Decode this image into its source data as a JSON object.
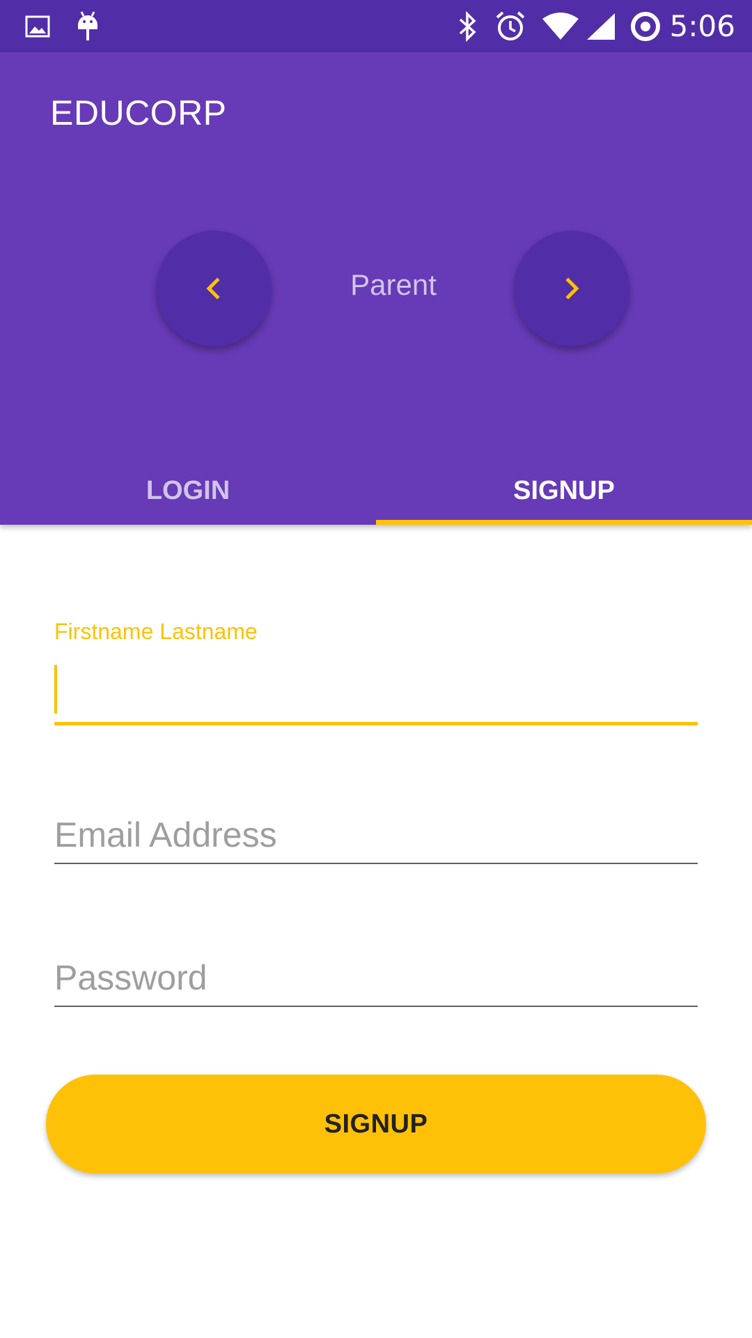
{
  "status_bar": {
    "time": "5:06",
    "icons": [
      "image-icon",
      "android-debug-icon",
      "bluetooth-icon",
      "alarm-icon",
      "wifi-icon",
      "signal-icon",
      "sync-icon"
    ]
  },
  "app_bar": {
    "title": "EDUCORP",
    "role_selector": {
      "current_role": "Parent",
      "prev_icon": "chevron-left-icon",
      "next_icon": "chevron-right-icon"
    }
  },
  "tabs": [
    {
      "label": "LOGIN",
      "active": false
    },
    {
      "label": "SIGNUP",
      "active": true
    }
  ],
  "form": {
    "name_label": "Firstname Lastname",
    "name_value": "",
    "email_placeholder": "Email Address",
    "password_placeholder": "Password",
    "submit_label": "SIGNUP"
  },
  "colors": {
    "primary": "#673AB7",
    "primary_dark": "#512DA8",
    "accent": "#FFC107",
    "tab_inactive": "#D1C4E9"
  }
}
